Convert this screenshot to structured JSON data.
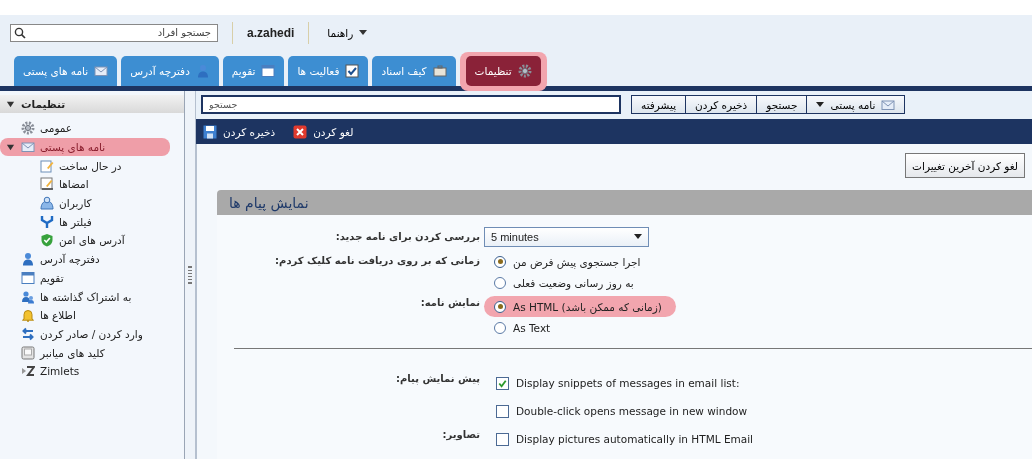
{
  "header": {
    "people_search": {
      "placeholder": "جستجو افراد"
    },
    "username": "a.zahedi",
    "help_menu": "راهنما"
  },
  "tabs": [
    {
      "label": "تنظیمات",
      "selected": true,
      "highlighted": true
    },
    {
      "label": "کیف اسناد",
      "selected": false,
      "highlighted": false
    },
    {
      "label": "فعالیت ها",
      "selected": false,
      "highlighted": false
    },
    {
      "label": "تقویم",
      "selected": false,
      "highlighted": false
    },
    {
      "label": "دفترچه آدرس",
      "selected": false,
      "highlighted": false
    },
    {
      "label": "نامه های پستی",
      "selected": false,
      "highlighted": false
    }
  ],
  "sidebar": {
    "title": "تنظیمات",
    "expanded": true,
    "items": [
      {
        "label": "عمومی",
        "selected": false,
        "highlighted": false
      },
      {
        "label": "نامه های پستی",
        "selected": true,
        "highlighted": true,
        "expanded": true,
        "children": [
          {
            "label": "در حال ساخت",
            "selected": false,
            "highlighted": false
          },
          {
            "label": "امضاها",
            "selected": false,
            "highlighted": false
          },
          {
            "label": "کاربران",
            "selected": false,
            "highlighted": false
          },
          {
            "label": "فیلتر ها",
            "selected": false,
            "highlighted": false
          },
          {
            "label": "آدرس های امن",
            "selected": false,
            "highlighted": false
          }
        ]
      },
      {
        "label": "دفترچه آدرس",
        "selected": false,
        "highlighted": false
      },
      {
        "label": "تقویم",
        "selected": false,
        "highlighted": false
      },
      {
        "label": "به اشتراک گذاشته ها",
        "selected": false,
        "highlighted": false
      },
      {
        "label": "اطلاع ها",
        "selected": false,
        "highlighted": false
      },
      {
        "label": "وارد کردن / صادر کردن",
        "selected": false,
        "highlighted": false
      },
      {
        "label": "کلید های میانبر",
        "selected": false,
        "highlighted": false
      },
      {
        "label": "Zimlets",
        "selected": false,
        "highlighted": false
      }
    ]
  },
  "search_bar": {
    "placeholder": "جستجو",
    "scope": "نامه پستی",
    "buttons": [
      "جستجو",
      "ذخیره کردن",
      "پیشرفته"
    ]
  },
  "toolbar": {
    "buttons": [
      "لغو کردن",
      "ذخیره کردن"
    ]
  },
  "revert_button": "لغو کردن آخرین تغییرات",
  "section": {
    "title": "نمایش پیام ها",
    "groups": [
      {
        "settings": [
          {
            "kind": "select",
            "label": "بررسی کردن برای نامه جدید:",
            "value": "5 minutes"
          },
          {
            "kind": "radio",
            "label": "زمانی که بر روی دریافت نامه کلیک کردم:",
            "options": [
              {
                "label": "اجرا جستجوی پیش فرض من",
                "selected": true,
                "highlighted": false
              },
              {
                "label": "به روز رسانی وضعیت فعلی",
                "selected": false,
                "highlighted": false
              }
            ]
          },
          {
            "kind": "radio",
            "label": "نمایش نامه:",
            "options": [
              {
                "label": "As HTML (زمانی که ممکن باشد)",
                "selected": true,
                "highlighted": true
              },
              {
                "label": "As Text",
                "selected": false,
                "highlighted": false
              }
            ]
          }
        ]
      },
      {
        "settings": [
          {
            "kind": "checkbox",
            "label": "پیش نمایش پیام:",
            "options": [
              {
                "label": "Display snippets of messages in email list:",
                "checked": true
              },
              {
                "label": "Double-click opens message in new window",
                "checked": false
              }
            ]
          },
          {
            "kind": "checkbox",
            "label": "تصاویر:",
            "options": [
              {
                "label": "Display pictures automatically in HTML Email",
                "checked": false
              }
            ]
          }
        ]
      }
    ]
  }
}
